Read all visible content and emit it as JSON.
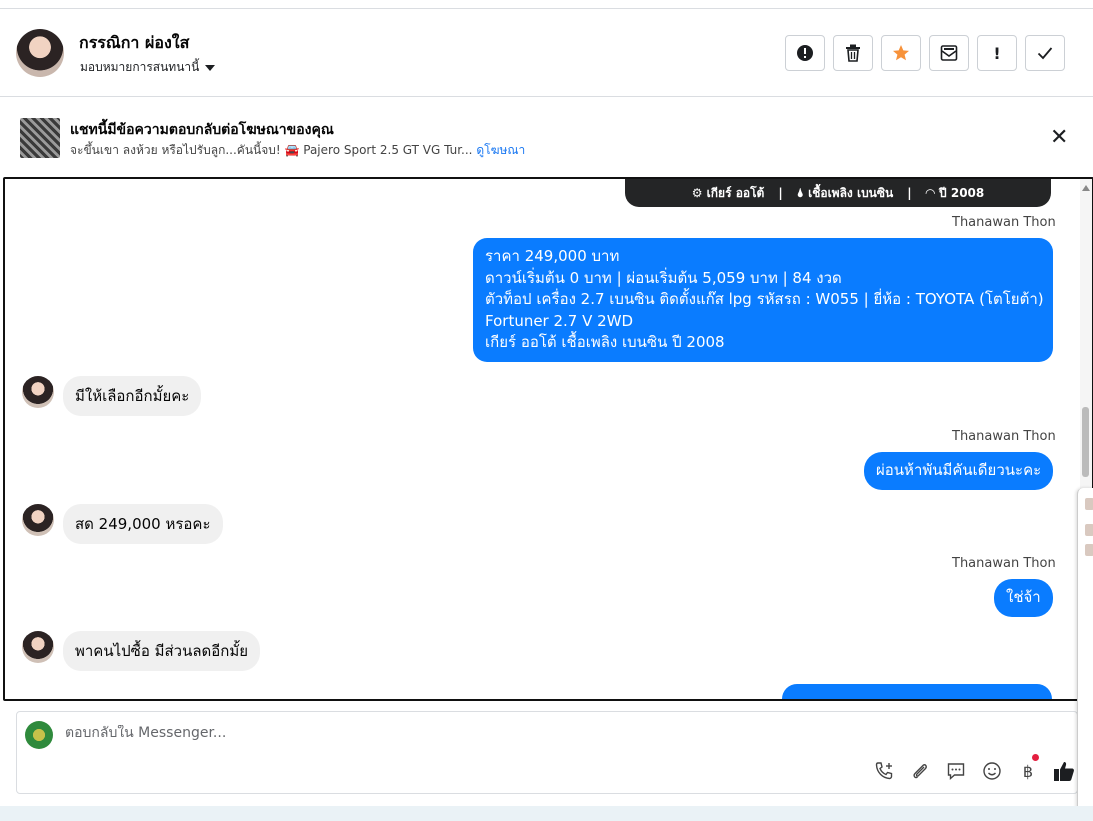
{
  "header": {
    "contact_name": "กรรณิกา ผ่องใส",
    "assign_label": "มอบหมายการสนทนานี้"
  },
  "ad_banner": {
    "title": "แชทนี้มีข้อความตอบกลับต่อโฆษณาของคุณ",
    "subtitle": "จะขึ้นเขา ลงห้วย หรือไปรับลูก...คันนี้จบ! 🚘 Pajero Sport 2.5 GT VG Tur...",
    "link": "ดูโฆษณา"
  },
  "chat": {
    "card_tail": {
      "gear": "⚙ เกียร์ ออโต้",
      "fuel": "🌢 เชื้อเพลิง เบนซิน",
      "year": "◠ ปี 2008",
      "sep": "|"
    },
    "messages": [
      {
        "from": "outgoing",
        "sender": "Thanawan Thon",
        "lines": [
          "ราคา 249,000 บาท",
          "ดาวน์เริ่มต้น 0 บาท | ผ่อนเริ่มต้น 5,059 บาท | 84 งวด",
          " ตัวท็อป เครื่อง 2.7 เบนซิน ติดตั้งแก๊ส lpg  รหัสรถ : W055 |  ยี่ห้อ : TOYOTA (โตโยต้า)",
          "Fortuner 2.7 V 2WD",
          " เกียร์ ออโต้  เชื้อเพลิง เบนซิน  ปี 2008"
        ]
      },
      {
        "from": "incoming",
        "text": "มีให้เลือกอีกมั้ยคะ"
      },
      {
        "from": "outgoing",
        "sender": "Thanawan Thon",
        "text": "ผ่อนห้าพันมีคันเดียวนะคะ"
      },
      {
        "from": "incoming",
        "text": "สด 249,000 หรอคะ"
      },
      {
        "from": "outgoing",
        "sender": "Thanawan Thon",
        "text": "ใช่จ้า"
      },
      {
        "from": "incoming",
        "text": "พาคนไปซื้อ มีส่วนลดอีกมั้ย"
      }
    ]
  },
  "composer": {
    "placeholder": "ตอบกลับใน Messenger...",
    "tools": [
      "phone-plus-icon",
      "attachment-icon",
      "saved-reply-icon",
      "emoji-icon",
      "baht-payment-icon",
      "thumbs-up-icon"
    ]
  },
  "actions": [
    "report-icon",
    "trash-icon",
    "star-icon",
    "mark-unread-icon",
    "important-icon",
    "done-icon"
  ],
  "colors": {
    "outgoing_bubble": "#0a7cff",
    "incoming_bubble": "#f0f0f0",
    "star": "#f7923a",
    "link": "#1877f2"
  }
}
